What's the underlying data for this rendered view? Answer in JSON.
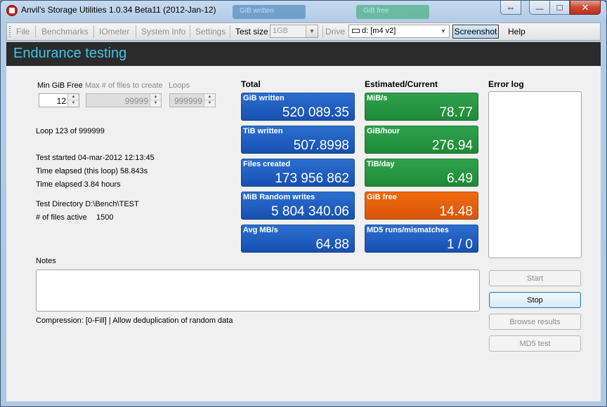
{
  "window": {
    "title": "Anvil's Storage Utilities 1.0.34 Beta11 (2012-Jan-12)",
    "bg_tab_1": "GiB written",
    "bg_tab_2": "GiB free",
    "controls": {
      "resize": "⇔",
      "minimize": "—",
      "maximize": "□",
      "close": "✕"
    }
  },
  "menu": {
    "file": "File",
    "benchmarks": "Benchmarks",
    "iometer": "IOmeter",
    "system_info": "System Info",
    "settings": "Settings",
    "test_size_label": "Test size",
    "test_size_value": "1GB",
    "drive_label": "Drive",
    "drive_value": "d: [m4 v2]",
    "screenshot": "Screenshot",
    "help": "Help"
  },
  "header": {
    "title": "Endurance testing"
  },
  "params": {
    "min_free_label": "Min GiB Free",
    "min_free_value": "12",
    "max_files_label": "Max # of files to create",
    "max_files_value": "99999",
    "loops_label": "Loops",
    "loops_value": "999999"
  },
  "status": {
    "loop": "Loop 123 of 999999",
    "started": "Test started 04-mar-2012 12:13:45",
    "elapsed_loop": "Time elapsed (this loop) 58.843s",
    "elapsed_total": "Time elapsed 3.84 hours",
    "directory": "Test Directory D:\\Bench\\TEST",
    "files_active_label": "# of files active",
    "files_active_value": "1500"
  },
  "total": {
    "heading": "Total",
    "tiles": [
      {
        "label": "GiB written",
        "value": "520 089.35"
      },
      {
        "label": "TiB written",
        "value": "507.8998"
      },
      {
        "label": "Files created",
        "value": "173 956 862"
      },
      {
        "label": "MiB Random writes",
        "value": "5 804 340.06"
      },
      {
        "label": "Avg MB/s",
        "value": "64.88"
      }
    ]
  },
  "estimated": {
    "heading": "Estimated/Current",
    "tiles": [
      {
        "label": "MiB/s",
        "value": "78.77"
      },
      {
        "label": "GiB/hour",
        "value": "276.94"
      },
      {
        "label": "TiB/day",
        "value": "6.49"
      },
      {
        "label": "GiB free",
        "value": "14.48"
      },
      {
        "label": "MD5 runs/mismatches",
        "value": "1 / 0"
      }
    ]
  },
  "error_log": {
    "heading": "Error log"
  },
  "notes": {
    "label": "Notes",
    "compression": "Compression: [0-Fill]  |  Allow deduplication of random data"
  },
  "buttons": {
    "start": "Start",
    "stop": "Stop",
    "browse": "Browse results",
    "md5": "MD5 test"
  },
  "colors": {
    "header_bg": "#2b2b2b",
    "header_text": "#3fc5e8",
    "tile_blue": "#1f5fc4",
    "tile_green": "#28963f",
    "tile_orange": "#e8600c"
  }
}
